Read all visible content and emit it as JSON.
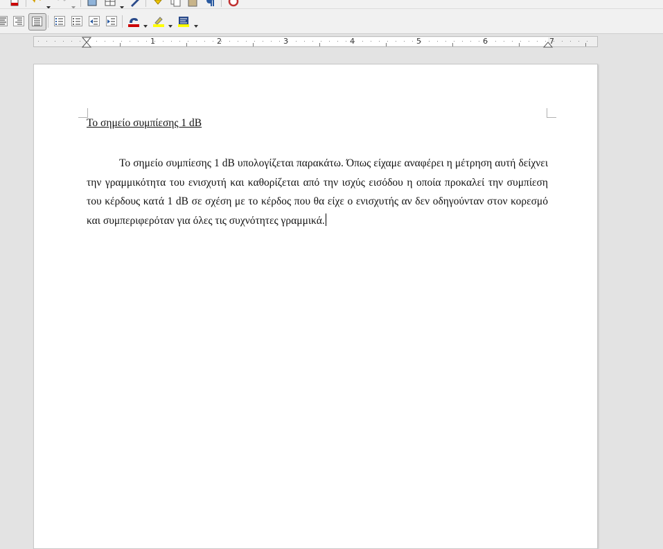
{
  "toolbar_top": {
    "icons": [
      "export-pdf-icon",
      "undo-icon",
      "redo-icon",
      "image-icon",
      "table-icon",
      "draw-icon",
      "highlight-icon",
      "copy-icon",
      "paste-icon",
      "paragraph-mark-icon",
      "help-icon"
    ]
  },
  "toolbar_format": {
    "icons": [
      "align-center-icon",
      "align-right-icon",
      "justify-icon",
      "numbered-list-icon",
      "bullet-list-icon",
      "decrease-indent-icon",
      "increase-indent-icon",
      "font-color-icon",
      "highlight-color-icon",
      "background-color-icon"
    ],
    "active": "justify-icon",
    "colors": {
      "font_color": "#cc0000",
      "highlight": "#ffff00",
      "background": "#ffff00"
    }
  },
  "ruler": {
    "numbers": [
      "1",
      "2",
      "3",
      "4",
      "5",
      "6",
      "7"
    ]
  },
  "document": {
    "title": "Το σημείο συμπίεσης 1 dB",
    "body": "Το σημείο συμπίεσης 1 dB υπολογίζεται παρακάτω. Όπως είχαμε αναφέρει η μέτρηση αυτή δείχνει την γραμμικότητα του ενισχυτή και καθορίζεται από την ισχύς εισόδου η οποία προκαλεί την συμπίεση του κέρδους κατά 1 dB σε σχέση με το κέρδος που θα είχε ο ενισχυτής αν δεν οδηγούνταν στον κορεσμό και συμπεριφερόταν για όλες τις συχνότητες γραμμικά."
  }
}
